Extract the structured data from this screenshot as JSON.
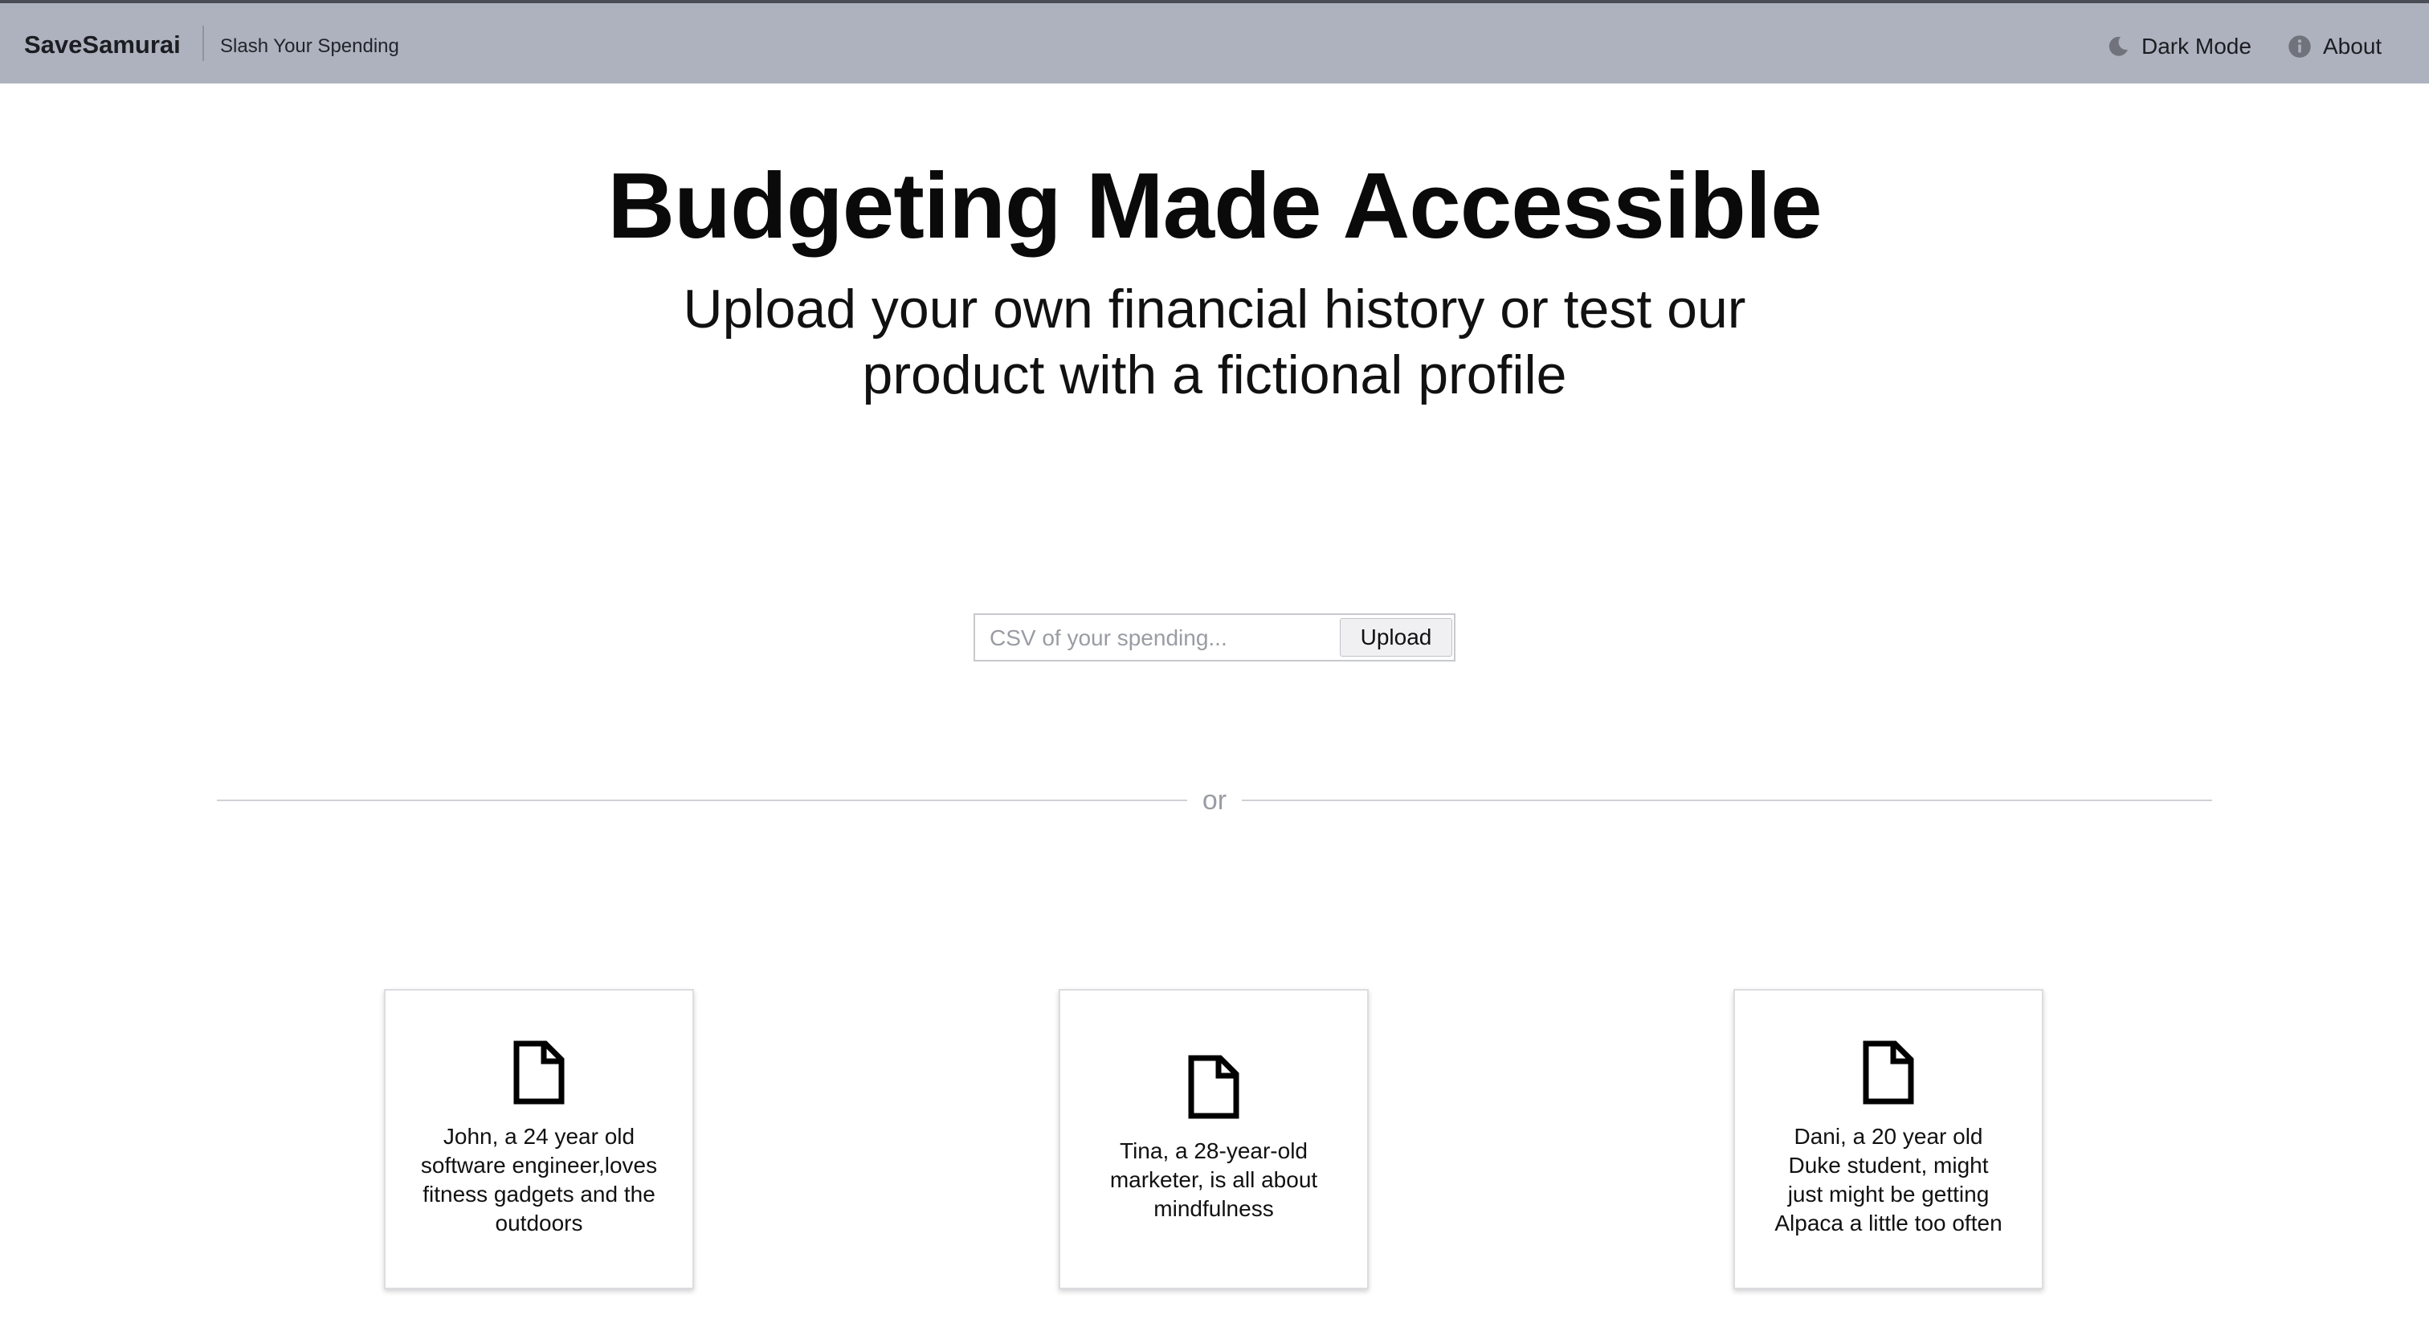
{
  "header": {
    "brand": "SaveSamurai",
    "tagline": "Slash Your Spending",
    "dark_mode_label": "Dark Mode",
    "about_label": "About"
  },
  "hero": {
    "title": "Budgeting Made Accessible",
    "subtitle": "Upload your own financial history or test our product with a fictional profile"
  },
  "upload": {
    "placeholder": "CSV of your spending...",
    "button_label": "Upload"
  },
  "divider": {
    "text": "or"
  },
  "profiles": [
    {
      "description": "John, a 24 year old software engineer,loves fitness gadgets and the outdoors",
      "icon": "file-icon"
    },
    {
      "description": "Tina, a 28-year-old marketer, is all about mindfulness",
      "icon": "file-icon"
    },
    {
      "description": "Dani, a 20 year old Duke student, might just might be getting Alpaca a little too often",
      "icon": "file-icon"
    }
  ]
}
